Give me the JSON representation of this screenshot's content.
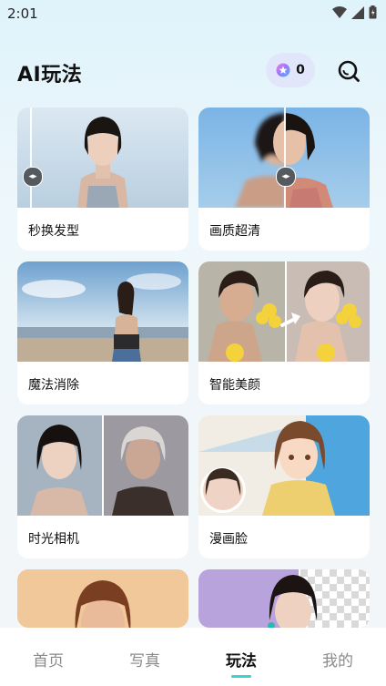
{
  "status": {
    "time": "2:01"
  },
  "header": {
    "title": "AI玩法",
    "coin_count": "0"
  },
  "cards": [
    {
      "label": "秒换发型"
    },
    {
      "label": "画质超清"
    },
    {
      "label": "魔法消除"
    },
    {
      "label": "智能美颜"
    },
    {
      "label": "时光相机"
    },
    {
      "label": "漫画脸"
    }
  ],
  "nav": {
    "items": [
      {
        "label": "首页"
      },
      {
        "label": "写真"
      },
      {
        "label": "玩法"
      },
      {
        "label": "我的"
      }
    ],
    "active": "玩法"
  },
  "colors": {
    "accent": "#3ad4c8",
    "coin_pill_bg": "#e1e6fb"
  }
}
